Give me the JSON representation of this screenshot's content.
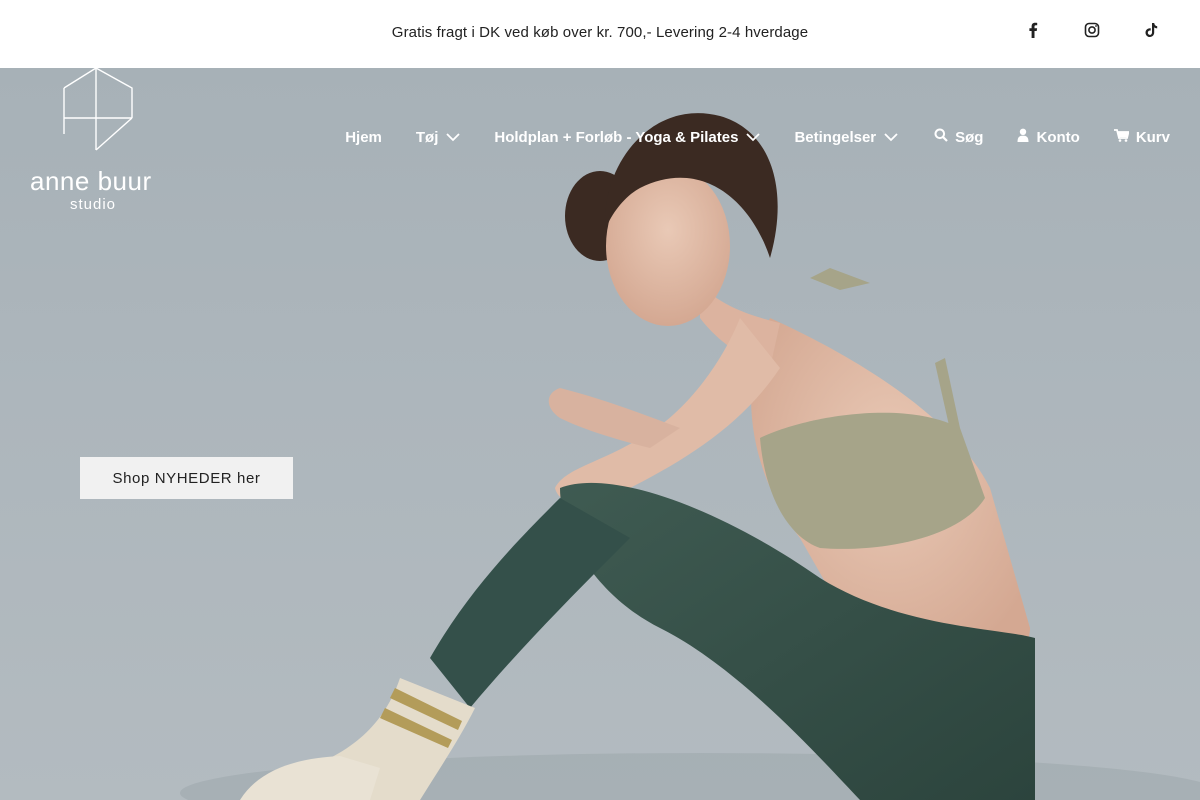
{
  "announcement": {
    "text": "Gratis fragt i DK ved køb over kr. 700,- Levering 2-4 hverdage"
  },
  "socials": [
    {
      "icon": "facebook-icon"
    },
    {
      "icon": "instagram-icon"
    },
    {
      "icon": "tiktok-icon"
    }
  ],
  "logo": {
    "name": "anne buur",
    "sub": "studio"
  },
  "nav": {
    "home": "Hjem",
    "clothing": "Tøj",
    "schedule": "Holdplan + Forløb - Yoga & Pilates",
    "terms": "Betingelser",
    "search": "Søg",
    "account": "Konto",
    "cart": "Kurv"
  },
  "hero": {
    "cta_label": "Shop NYHEDER her"
  },
  "colors": {
    "background_hero": "#adb6bc",
    "text_dark": "#222222",
    "nav_text": "#ffffff",
    "cta_bg": "#f1f1f1"
  }
}
